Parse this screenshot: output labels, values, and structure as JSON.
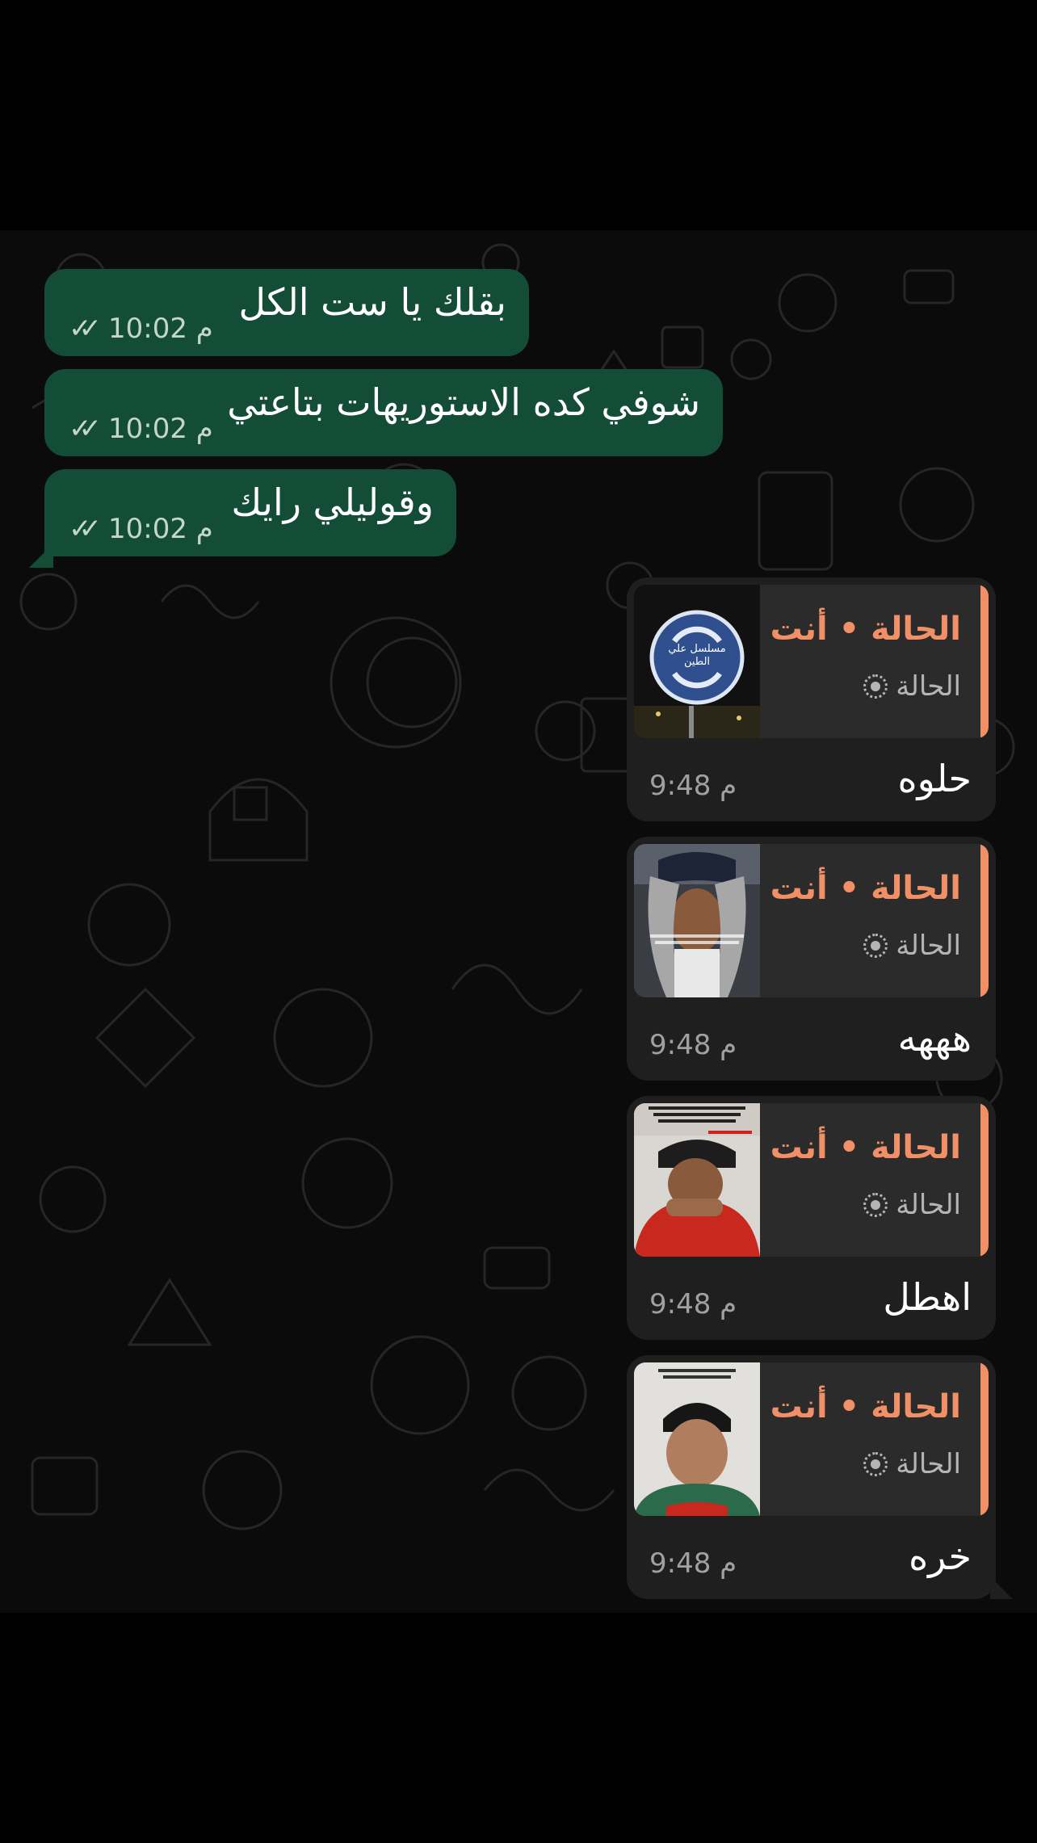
{
  "sent_messages": [
    {
      "text": "بقلك يا ست الكل",
      "time": "10:02 م",
      "ticks": "✓✓"
    },
    {
      "text": "شوفي كده الاستوريهات بتاعتي",
      "time": "10:02 م",
      "ticks": "✓✓"
    },
    {
      "text": "وقوليلي رايك",
      "time": "10:02 م",
      "ticks": "✓✓"
    }
  ],
  "status_replies": [
    {
      "quote_title": "الحالة • أنت",
      "quote_sub": "الحالة",
      "thumb_caption": "مسلسل علي الطين",
      "text": "حلوه",
      "time": "9:48 م"
    },
    {
      "quote_title": "الحالة • أنت",
      "quote_sub": "الحالة",
      "text": "هههه",
      "time": "9:48 م"
    },
    {
      "quote_title": "الحالة • أنت",
      "quote_sub": "الحالة",
      "text": "اهطل",
      "time": "9:48 م"
    },
    {
      "quote_title": "الحالة • أنت",
      "quote_sub": "الحالة",
      "text": "خره",
      "time": "9:48 م"
    }
  ],
  "colors": {
    "sent_bubble": "#134d37",
    "received_bubble": "#1f1f1f",
    "quote_accent": "#f18f66",
    "chat_background": "#0b0b0b"
  }
}
